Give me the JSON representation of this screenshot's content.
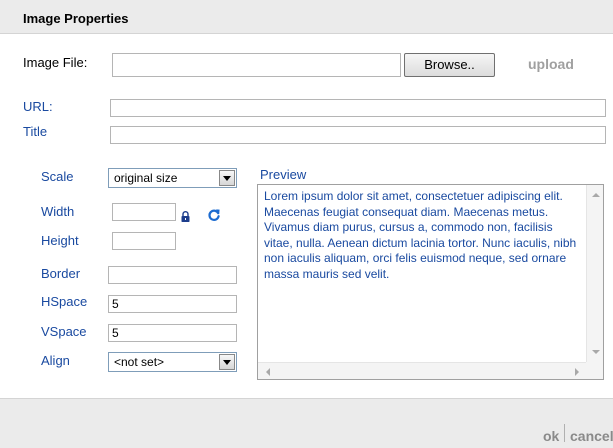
{
  "dialog": {
    "title": "Image Properties"
  },
  "image_file": {
    "label": "Image File:",
    "value": "",
    "browse_label": "Browse..",
    "upload_label": "upload"
  },
  "url": {
    "label": "URL:",
    "value": ""
  },
  "title_field": {
    "label": "Title",
    "value": ""
  },
  "scale": {
    "label": "Scale",
    "selected": "original size"
  },
  "width": {
    "label": "Width",
    "value": ""
  },
  "height": {
    "label": "Height",
    "value": ""
  },
  "border": {
    "label": "Border",
    "value": ""
  },
  "hspace": {
    "label": "HSpace",
    "value": "5"
  },
  "vspace": {
    "label": "VSpace",
    "value": "5"
  },
  "align": {
    "label": "Align",
    "selected": "<not set>"
  },
  "preview": {
    "label": "Preview",
    "text": "Lorem ipsum dolor sit amet, consectetuer adipiscing elit. Maecenas feugiat consequat diam. Maecenas metus. Vivamus diam purus, cursus a, commodo non, facilisis vitae, nulla. Aenean dictum lacinia tortor. Nunc iaculis, nibh non iaculis aliquam, orci felis euismod neque, sed ornare massa mauris sed velit."
  },
  "footer": {
    "ok_label": "ok",
    "cancel_label": "cancel"
  },
  "colors": {
    "label_blue": "#1a4aa0",
    "header_bg": "#ebebeb",
    "action_gray": "#8a8a8a"
  },
  "icons": {
    "lock": "lock-icon",
    "refresh": "refresh-icon"
  }
}
